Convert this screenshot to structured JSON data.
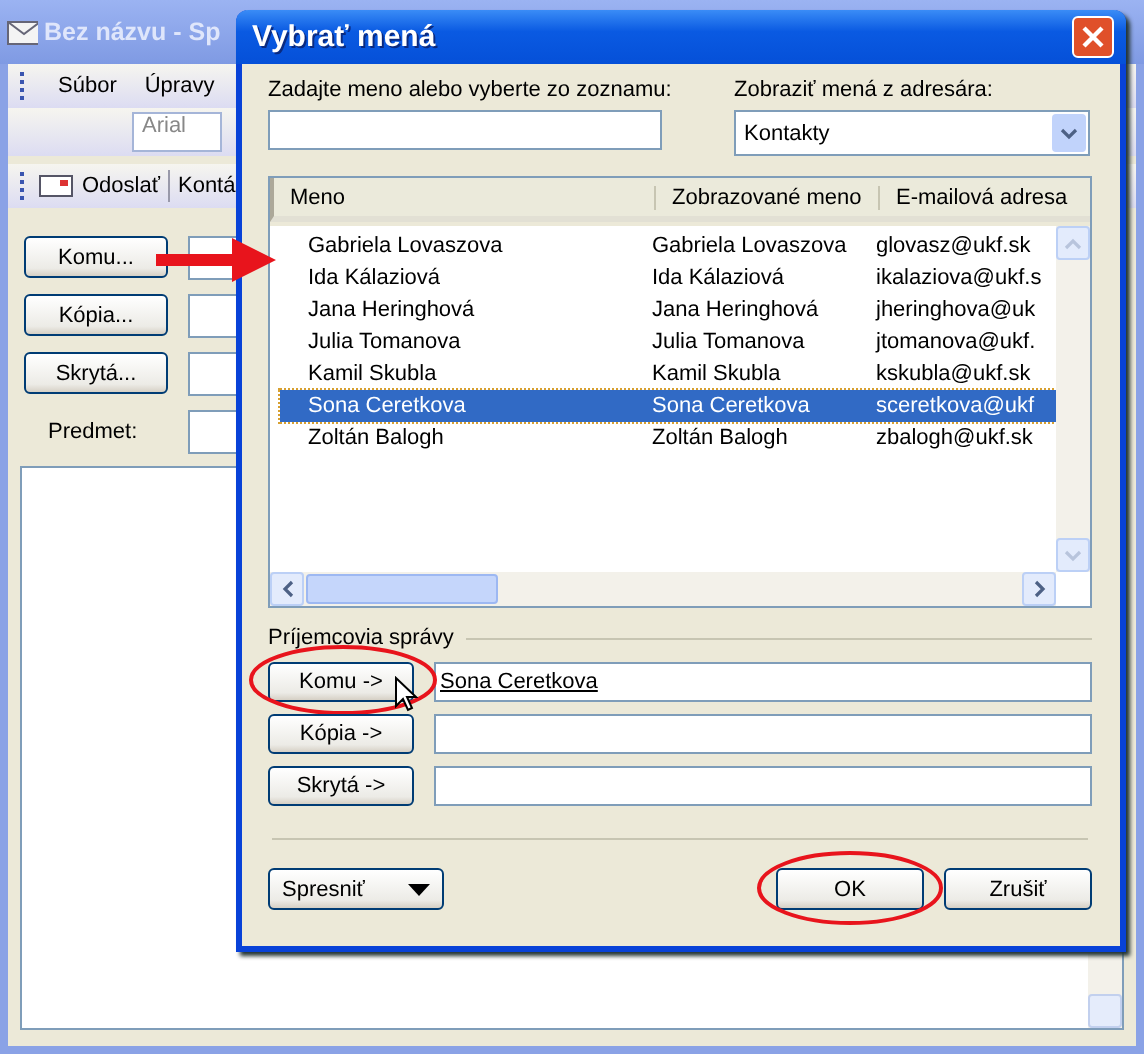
{
  "window": {
    "title": "Bez názvu - Sp",
    "menu": [
      "Súbor",
      "Úpravy"
    ],
    "font_box": "Arial",
    "toolbar": [
      "Odoslať",
      "Kontá"
    ],
    "address_buttons": [
      "Komu...",
      "Kópia...",
      "Skrytá..."
    ],
    "subject_label": "Predmet:"
  },
  "dialog": {
    "title": "Vybrať mená",
    "search_label": "Zadajte meno alebo vyberte zo zoznamu:",
    "address_book_label": "Zobraziť mená z adresára:",
    "address_book": "Kontakty",
    "columns": [
      "Meno",
      "Zobrazované meno",
      "E-mailová adresa"
    ],
    "rows": [
      {
        "name": "Gabriela Lovaszova",
        "display": "Gabriela Lovaszova",
        "email": "glovasz@ukf.sk",
        "selected": false
      },
      {
        "name": "Ida Kálaziová",
        "display": "Ida Kálaziová",
        "email": "ikalaziova@ukf.s",
        "selected": false
      },
      {
        "name": "Jana Heringhová",
        "display": "Jana Heringhová",
        "email": "jheringhova@uk",
        "selected": false
      },
      {
        "name": "Julia Tomanova",
        "display": "Julia Tomanova",
        "email": "jtomanova@ukf.",
        "selected": false
      },
      {
        "name": "Kamil Skubla",
        "display": "Kamil Skubla",
        "email": "kskubla@ukf.sk",
        "selected": false
      },
      {
        "name": "Sona Ceretkova",
        "display": "Sona Ceretkova",
        "email": "sceretkova@ukf",
        "selected": true
      },
      {
        "name": "Zoltán Balogh",
        "display": "Zoltán Balogh",
        "email": "zbalogh@ukf.sk",
        "selected": false
      }
    ],
    "recipients_label": "Príjemcovia správy",
    "recipients": [
      {
        "button": "Komu ->",
        "value": "Sona Ceretkova",
        "circled": true
      },
      {
        "button": "Kópia ->",
        "circled": false
      },
      {
        "button": "Skrytá ->",
        "circled": false
      }
    ],
    "advanced_button": "Spresniť",
    "ok_button": {
      "label": "OK",
      "circled": true
    },
    "cancel_button": "Zrušiť"
  }
}
